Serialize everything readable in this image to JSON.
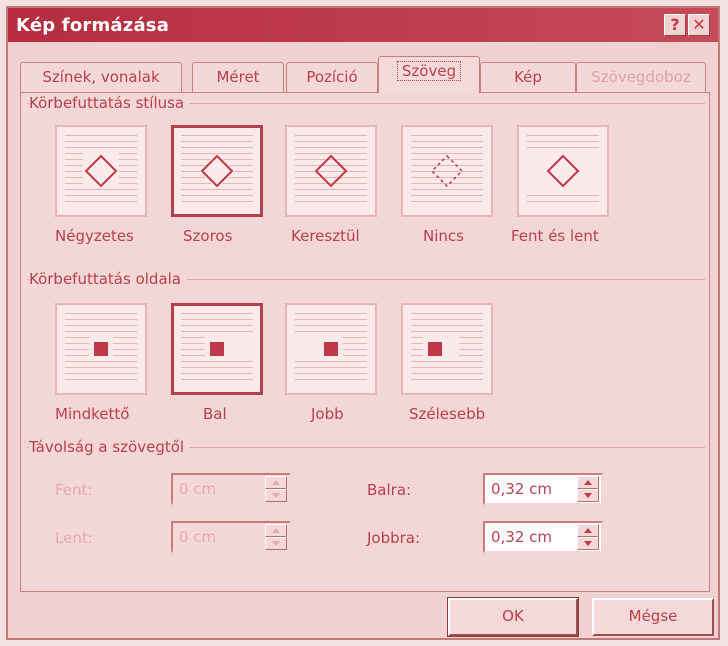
{
  "title": "Kép formázása",
  "titlebar": {
    "help_label": "?",
    "close_label": "✕"
  },
  "tabs": [
    {
      "label": "Színek, vonalak"
    },
    {
      "label": "Méret"
    },
    {
      "label": "Pozíció"
    },
    {
      "label": "Szöveg"
    },
    {
      "label": "Kép"
    },
    {
      "label": "Szövegdoboz"
    }
  ],
  "wrap_style": {
    "heading": "Körbefuttatás stílusa",
    "options": [
      {
        "label": "Négyzetes",
        "icon": "wrap-square-icon"
      },
      {
        "label": "Szoros",
        "icon": "wrap-tight-icon"
      },
      {
        "label": "Keresztül",
        "icon": "wrap-through-icon"
      },
      {
        "label": "Nincs",
        "icon": "wrap-none-icon"
      },
      {
        "label": "Fent és lent",
        "icon": "wrap-top-bottom-icon"
      }
    ]
  },
  "wrap_side": {
    "heading": "Körbefuttatás oldala",
    "options": [
      {
        "label": "Mindkettő",
        "icon": "wrap-both-sides-icon"
      },
      {
        "label": "Bal",
        "icon": "wrap-left-icon"
      },
      {
        "label": "Jobb",
        "icon": "wrap-right-icon"
      },
      {
        "label": "Szélesebb",
        "icon": "wrap-largest-side-icon"
      }
    ]
  },
  "distance": {
    "heading": "Távolság a szövegtől",
    "top": {
      "label": "Fent:",
      "value": "0 cm"
    },
    "bottom": {
      "label": "Lent:",
      "value": "0 cm"
    },
    "left": {
      "label": "Balra:",
      "value": "0,32 cm"
    },
    "right": {
      "label": "Jobbra:",
      "value": "0,32 cm"
    }
  },
  "buttons": {
    "ok": "OK",
    "cancel": "Mégse"
  }
}
